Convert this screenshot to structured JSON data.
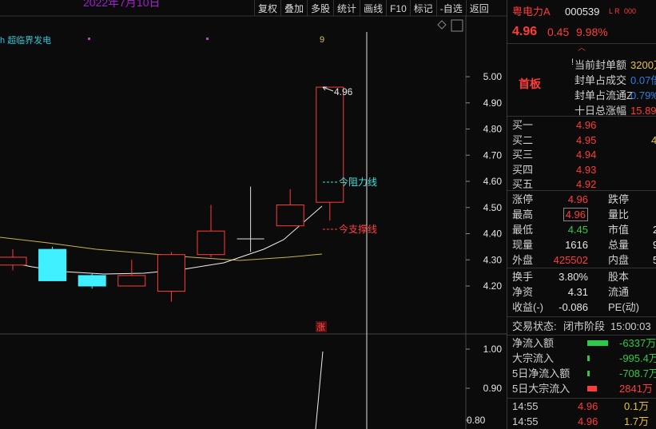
{
  "chart": {
    "title": "2022年7月10日",
    "indicator_label": "超临界发电",
    "toolbar": [
      "复权",
      "叠加",
      "多股",
      "统计",
      "画线",
      "F10",
      "标记",
      "-自选",
      "返回"
    ],
    "price_axis": [
      "5.00",
      "4.90",
      "4.80",
      "4.70",
      "4.60",
      "4.50",
      "4.40",
      "4.30",
      "4.20"
    ],
    "lower_axis": [
      "1.00",
      "0.90",
      "0.80"
    ],
    "high_label": "4.96",
    "resistance_label": "今阻力线",
    "support_label": "今支撑线",
    "marker_9": "9",
    "zhang_badge": "涨",
    "colors": {
      "up": "#ff3b3b",
      "down": "#40f0ff",
      "ma_white": "#f0f0f0",
      "ma_yellow": "#c8b44a",
      "cursor": "#e0e0e0"
    },
    "candles": [
      {
        "o": 4.31,
        "c": 4.28,
        "h": 4.34,
        "l": 4.26,
        "up": true
      },
      {
        "o": 4.34,
        "c": 4.22,
        "h": 4.35,
        "l": 4.22,
        "up": false
      },
      {
        "o": 4.24,
        "c": 4.2,
        "h": 4.25,
        "l": 4.19,
        "up": false
      },
      {
        "o": 4.2,
        "c": 4.24,
        "h": 4.3,
        "l": 4.2,
        "up": true
      },
      {
        "o": 4.18,
        "c": 4.32,
        "h": 4.33,
        "l": 4.14,
        "up": true
      },
      {
        "o": 4.32,
        "c": 4.41,
        "h": 4.51,
        "l": 4.31,
        "up": true
      },
      {
        "o": 4.38,
        "c": 4.38,
        "h": 4.58,
        "l": 4.33,
        "up": true
      },
      {
        "o": 4.43,
        "c": 4.51,
        "h": 4.57,
        "l": 4.43,
        "up": true
      },
      {
        "o": 4.52,
        "c": 4.96,
        "h": 4.96,
        "l": 4.45,
        "up": true
      }
    ]
  },
  "stock": {
    "name": "粤电力A",
    "code": "000539",
    "tags": "L R",
    "tag_suffix": "000",
    "price": "4.96",
    "change": "0.45",
    "change_pct": "9.98%",
    "expand_icon": "chevron-up-icon",
    "board_label": "首板",
    "seal_rows": [
      {
        "label": "当前封单额",
        "value": "3200万"
      },
      {
        "label": "封单占成交",
        "value": "0.07倍"
      },
      {
        "label": "封单占流通Z",
        "value": "0.79‰"
      },
      {
        "label": "十日总涨幅",
        "value": "15.89"
      }
    ],
    "bids": [
      {
        "label": "买一",
        "price": "4.96",
        "vol": ""
      },
      {
        "label": "买二",
        "price": "4.95",
        "vol": "4"
      },
      {
        "label": "买三",
        "price": "4.94",
        "vol": ""
      },
      {
        "label": "买四",
        "price": "4.93",
        "vol": ""
      },
      {
        "label": "买五",
        "price": "4.92",
        "vol": ""
      }
    ],
    "quote": [
      {
        "l1": "涨停",
        "v1": "4.96",
        "c1": "red",
        "l2": "跌停",
        "v2": ""
      },
      {
        "l1": "最高",
        "v1": "4.96",
        "c1": "red",
        "l2": "量比",
        "v2": ""
      },
      {
        "l1": "最低",
        "v1": "4.45",
        "c1": "grn",
        "l2": "市值",
        "v2": "2"
      },
      {
        "l1": "现量",
        "v1": "1616",
        "c1": "wht",
        "l2": "总量",
        "v2": "9"
      },
      {
        "l1": "外盘",
        "v1": "425502",
        "c1": "red",
        "l2": "内盘",
        "v2": "5"
      }
    ],
    "fundamentals": [
      {
        "l1": "换手",
        "v1": "3.80%",
        "l2": "股本",
        "v2": ""
      },
      {
        "l1": "净资",
        "v1": "4.31",
        "l2": "流通",
        "v2": ""
      },
      {
        "l1": "收益(-)",
        "v1": "-0.086",
        "l2": "PE(动)",
        "v2": ""
      }
    ],
    "trade_status_label": "交易状态:",
    "trade_status": "闭市阶段",
    "trade_time": "15:00:03",
    "flows": [
      {
        "label": "净流入额",
        "bar": "grn-long",
        "value": "-6337万",
        "color": "grn"
      },
      {
        "label": "大宗流入",
        "bar": "grn-short",
        "value": "-995.4万",
        "color": "grn"
      },
      {
        "label": "5日净流入额",
        "bar": "grn-short",
        "value": "-708.7万",
        "color": "grn"
      },
      {
        "label": "5日大宗流入",
        "bar": "red",
        "value": "2841万",
        "color": "red"
      }
    ],
    "ticks": [
      {
        "time": "14:55",
        "price": "4.96",
        "vol": "0.1万"
      },
      {
        "time": "14:55",
        "price": "4.96",
        "vol": "1.7万"
      }
    ]
  }
}
